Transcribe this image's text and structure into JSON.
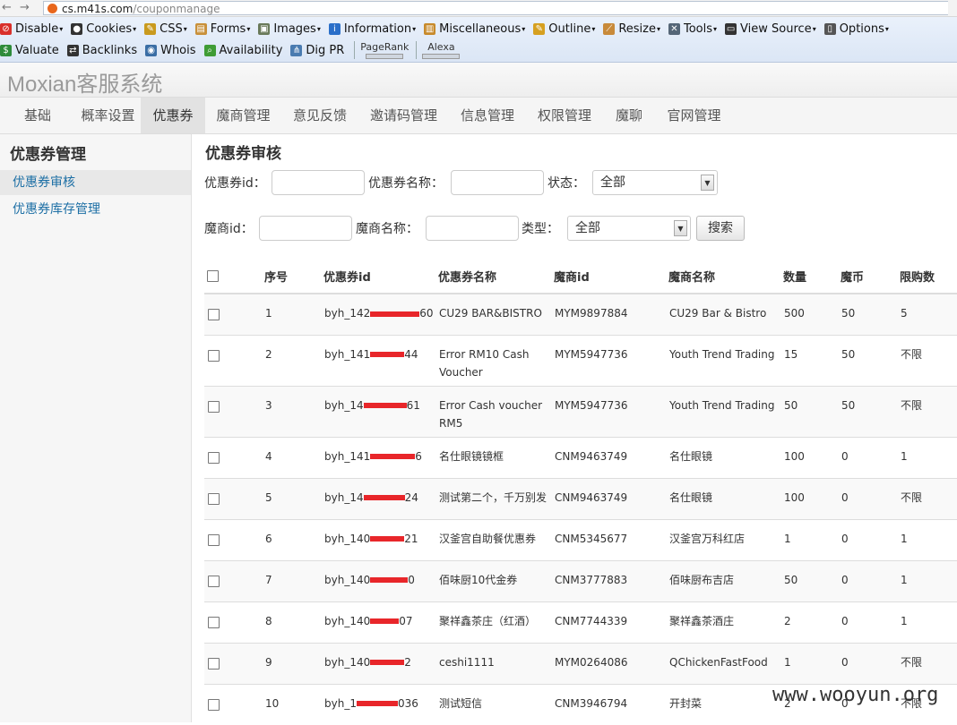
{
  "browser": {
    "url_host": "cs.m41s.com",
    "url_path": "/couponmanage",
    "toolbar_row1": [
      {
        "label": "Disable",
        "icon": "no-entry-icon",
        "color": "#d9302b",
        "dropdown": true
      },
      {
        "label": "Cookies",
        "icon": "person-icon",
        "color": "#333333",
        "dropdown": true
      },
      {
        "label": "CSS",
        "icon": "pencil-icon",
        "color": "#c99a1e",
        "dropdown": true
      },
      {
        "label": "Forms",
        "icon": "clipboard-icon",
        "color": "#c8903a",
        "dropdown": true
      },
      {
        "label": "Images",
        "icon": "picture-icon",
        "color": "#6a7a5a",
        "dropdown": true
      },
      {
        "label": "Information",
        "icon": "info-icon",
        "color": "#2a6fc9",
        "dropdown": true
      },
      {
        "label": "Miscellaneous",
        "icon": "notepad-icon",
        "color": "#c78a2b",
        "dropdown": true
      },
      {
        "label": "Outline",
        "icon": "pencil-icon",
        "color": "#d6a020",
        "dropdown": true
      },
      {
        "label": "Resize",
        "icon": "ruler-icon",
        "color": "#c88a3a",
        "dropdown": true
      },
      {
        "label": "Tools",
        "icon": "tools-icon",
        "color": "#556677",
        "dropdown": true
      },
      {
        "label": "View Source",
        "icon": "monitor-icon",
        "color": "#333333",
        "dropdown": true
      },
      {
        "label": "Options",
        "icon": "options-icon",
        "color": "#555555",
        "dropdown": true
      }
    ],
    "toolbar_row2": [
      {
        "label": "Valuate",
        "icon": "dollar-icon",
        "color": "#2e8b3a"
      },
      {
        "label": "Backlinks",
        "icon": "arrows-icon",
        "color": "#333333"
      },
      {
        "label": "Whois",
        "icon": "globe-icon",
        "color": "#3a6ea5"
      },
      {
        "label": "Availability",
        "icon": "magnifier-icon",
        "color": "#3f9c35"
      },
      {
        "label": "Dig PR",
        "icon": "network-icon",
        "color": "#4a7bb0"
      }
    ],
    "pagerank_label": "PageRank",
    "alexa_label": "Alexa"
  },
  "app": {
    "title": "Moxian客服系统"
  },
  "nav": {
    "tabs": [
      "基础",
      "概率设置",
      "优惠券",
      "魔商管理",
      "意见反馈",
      "邀请码管理",
      "信息管理",
      "权限管理",
      "魔聊",
      "官网管理"
    ],
    "active": "优惠券"
  },
  "sidebar": {
    "title": "优惠券管理",
    "items": [
      "优惠券审核",
      "优惠券库存管理"
    ]
  },
  "main": {
    "title": "优惠券审核",
    "filters": {
      "coupon_id_label": "优惠券id：",
      "coupon_name_label": "优惠券名称：",
      "status_label": "状态：",
      "status_value": "全部",
      "merchant_id_label": "魔商id：",
      "merchant_name_label": "魔商名称：",
      "type_label": "类型：",
      "type_value": "全部",
      "search_label": "搜索"
    },
    "table": {
      "headers": [
        "序号",
        "优惠券id",
        "优惠券名称",
        "魔商id",
        "魔商名称",
        "数量",
        "魔币",
        "限购数"
      ],
      "rows": [
        {
          "no": "1",
          "cid_prefix": "byh_142",
          "cid_suffix": "60",
          "name": "CU29 BAR&BISTRO",
          "mid": "MYM9897884",
          "mname": "CU29 Bar & Bistro",
          "qty": "500",
          "coin": "50",
          "limit": "5"
        },
        {
          "no": "2",
          "cid_prefix": "byh_141",
          "cid_suffix": "44",
          "name": "Error RM10 Cash Voucher",
          "mid": "MYM5947736",
          "mname": "Youth Trend Trading",
          "qty": "15",
          "coin": "50",
          "limit": "不限"
        },
        {
          "no": "3",
          "cid_prefix": "byh_14",
          "cid_suffix": "61",
          "name": "Error Cash voucher RM5",
          "mid": "MYM5947736",
          "mname": "Youth Trend Trading",
          "qty": "50",
          "coin": "50",
          "limit": "不限"
        },
        {
          "no": "4",
          "cid_prefix": "byh_141",
          "cid_suffix": "6",
          "name": "名仕眼镜镜框",
          "mid": "CNM9463749",
          "mname": "名仕眼镜",
          "qty": "100",
          "coin": "0",
          "limit": "1"
        },
        {
          "no": "5",
          "cid_prefix": "byh_14",
          "cid_suffix": "24",
          "name": "测试第二个，千万别发",
          "mid": "CNM9463749",
          "mname": "名仕眼镜",
          "qty": "100",
          "coin": "0",
          "limit": "不限"
        },
        {
          "no": "6",
          "cid_prefix": "byh_140",
          "cid_suffix": "21",
          "name": "汉釜宫自助餐优惠券",
          "mid": "CNM5345677",
          "mname": "汉釜宫万科红店",
          "qty": "1",
          "coin": "0",
          "limit": "1"
        },
        {
          "no": "7",
          "cid_prefix": "byh_140",
          "cid_suffix": "0",
          "name": "佰味厨10代金券",
          "mid": "CNM3777883",
          "mname": "佰味厨布吉店",
          "qty": "50",
          "coin": "0",
          "limit": "1"
        },
        {
          "no": "8",
          "cid_prefix": "byh_140",
          "cid_suffix": "07",
          "name": "聚祥鑫茶庄（红酒）",
          "mid": "CNM7744339",
          "mname": "聚祥鑫茶酒庄",
          "qty": "2",
          "coin": "0",
          "limit": "1"
        },
        {
          "no": "9",
          "cid_prefix": "byh_140",
          "cid_suffix": "2",
          "name": "ceshi1111",
          "mid": "MYM0264086",
          "mname": "QChickenFastFood",
          "qty": "1",
          "coin": "0",
          "limit": "不限"
        },
        {
          "no": "10",
          "cid_prefix": "byh_1",
          "cid_suffix": "036",
          "name": "测试短信",
          "mid": "CNM3946794",
          "mname": "开封菜",
          "qty": "2",
          "coin": "0",
          "limit": "不限"
        }
      ]
    }
  },
  "watermark": "www.wooyun.org"
}
